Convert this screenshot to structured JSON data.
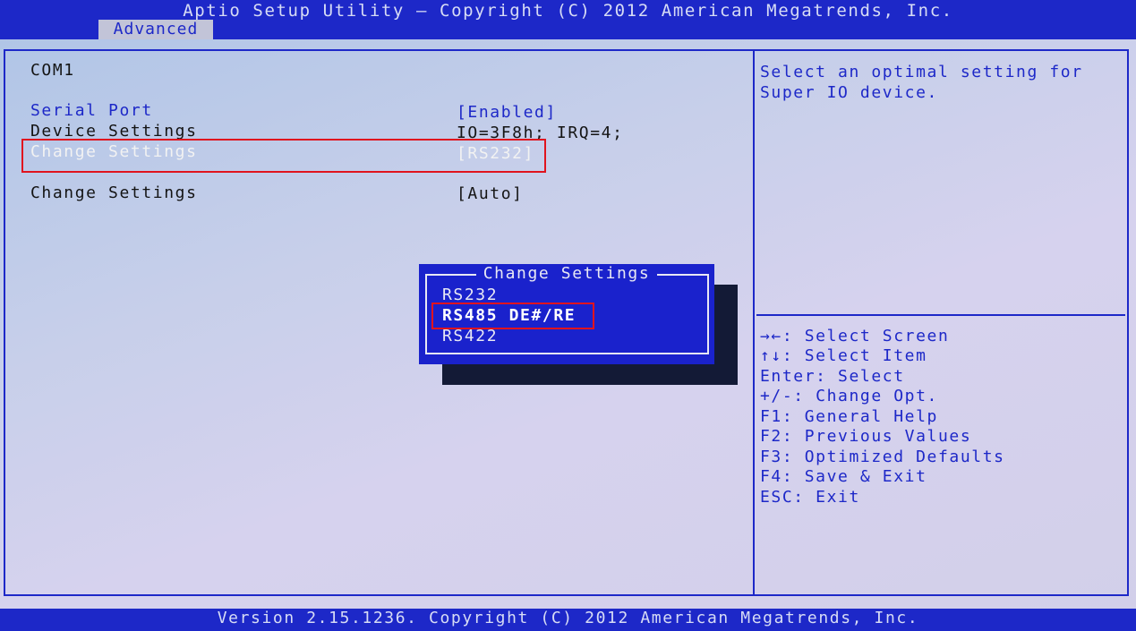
{
  "header": {
    "title": "Aptio Setup Utility – Copyright (C) 2012 American Megatrends, Inc.",
    "tab": "Advanced"
  },
  "main": {
    "section_title": "COM1",
    "rows": [
      {
        "label": "Serial Port",
        "value": "[Enabled]"
      },
      {
        "label": "Device Settings",
        "value": "IO=3F8h; IRQ=4;"
      },
      {
        "label": "Change Settings",
        "value": "[RS232]"
      },
      {
        "label": "Change Settings",
        "value": "[Auto]"
      }
    ]
  },
  "popup": {
    "title": "Change Settings",
    "options": [
      "RS232",
      "RS485 DE#/RE",
      "RS422"
    ],
    "selected_index": 1
  },
  "help": {
    "lines": [
      "Select an optimal setting for",
      "Super IO device."
    ]
  },
  "keys": [
    "→←: Select Screen",
    "↑↓: Select Item",
    "Enter: Select",
    "+/-: Change Opt.",
    "F1: General Help",
    "F2: Previous Values",
    "F3: Optimized Defaults",
    "F4: Save & Exit",
    "ESC: Exit"
  ],
  "footer": {
    "text": "Version 2.15.1236. Copyright (C) 2012 American Megatrends, Inc."
  },
  "colors": {
    "accent_blue": "#1d28c8",
    "highlight_red": "#e0141e"
  }
}
